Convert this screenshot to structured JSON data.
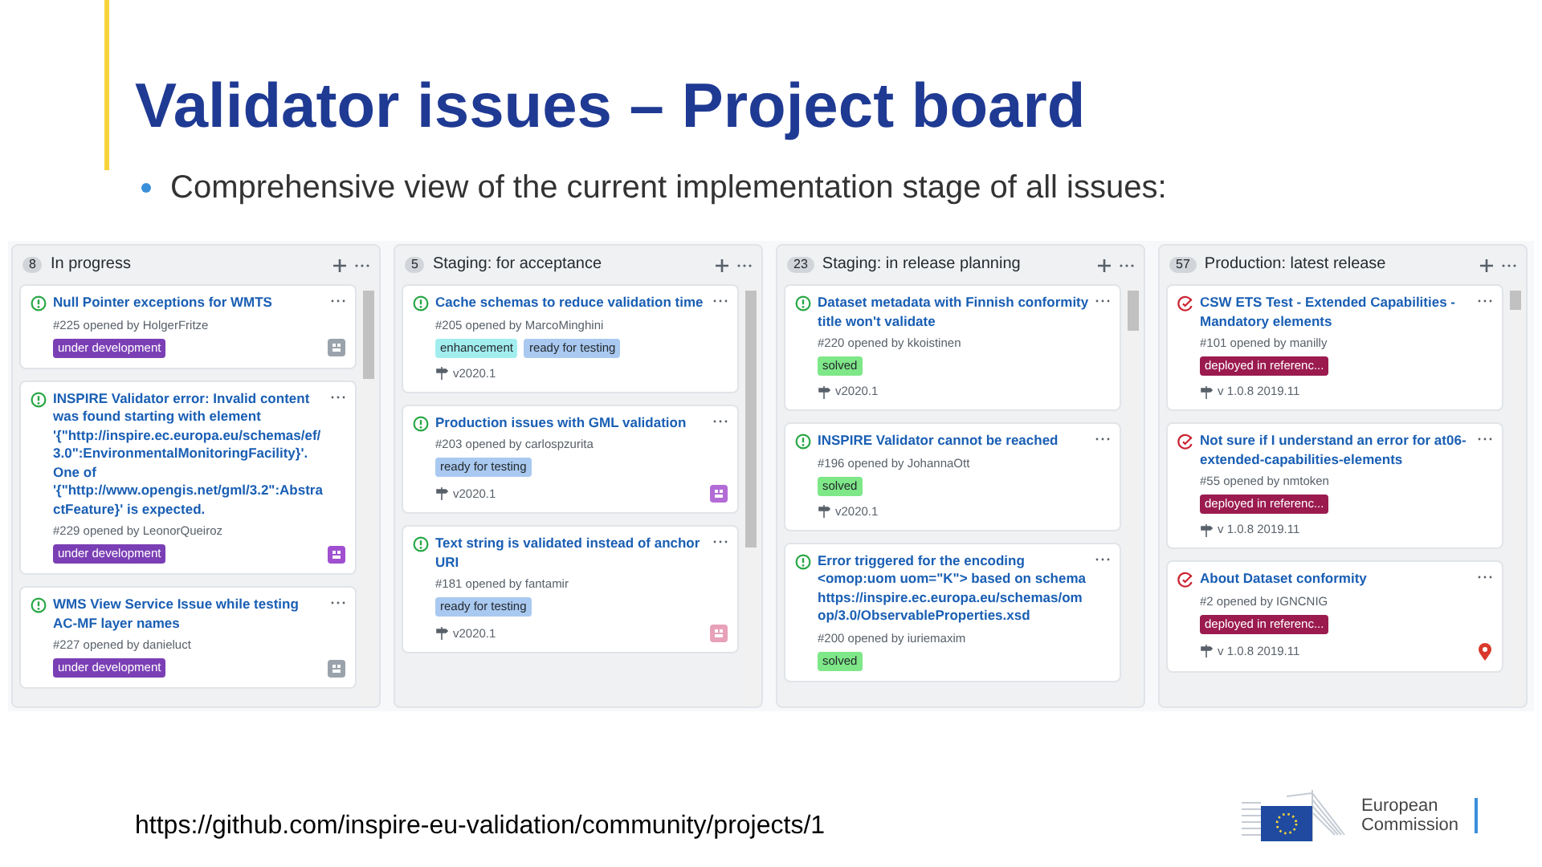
{
  "title": "Validator issues – Project board",
  "bullet": "Comprehensive view of the current implementation stage of all issues:",
  "board": {
    "columns": [
      {
        "count": "8",
        "title": "In progress",
        "cards": [
          {
            "kind": "open",
            "title": "Null Pointer exceptions for WMTS",
            "meta": "#225 opened by HolgerFritze",
            "labels": [
              {
                "text": "under development",
                "color": "#7b3fb5"
              }
            ],
            "avatar": {
              "kind": "identicon",
              "color": "#9aa3ab"
            }
          },
          {
            "kind": "open",
            "title": "INSPIRE Validator error: Invalid content was found starting with element '{\"http://inspire.ec.europa.eu/schemas/ef/3.0\":EnvironmentalMonitoringFacility}'. One of '{\"http://www.opengis.net/gml/3.2\":AbstractFeature}' is expected.",
            "meta": "#229 opened by LeonorQueiroz",
            "labels": [
              {
                "text": "under development",
                "color": "#7b3fb5"
              }
            ],
            "avatar": {
              "kind": "identicon",
              "color": "#a04fd0"
            }
          },
          {
            "kind": "open",
            "title": "WMS View Service Issue while testing AC-MF layer names",
            "meta": "#227 opened by danieluct",
            "labels": [
              {
                "text": "under development",
                "color": "#7b3fb5"
              }
            ],
            "avatar": {
              "kind": "identicon",
              "color": "#9aa3ab"
            }
          }
        ]
      },
      {
        "count": "5",
        "title": "Staging: for acceptance",
        "cards": [
          {
            "kind": "open",
            "title": "Cache schemas to reduce validation time",
            "meta": "#205 opened by MarcoMinghini",
            "labels": [
              {
                "text": "enhancement",
                "color": "#a2eeef"
              },
              {
                "text": "ready for testing",
                "color": "#a9c9f0"
              }
            ],
            "milestone": "v2020.1"
          },
          {
            "kind": "open",
            "title": "Production issues with GML validation",
            "meta": "#203 opened by carlospzurita",
            "labels": [
              {
                "text": "ready for testing",
                "color": "#a9c9f0"
              }
            ],
            "milestone": "v2020.1",
            "avatar": {
              "kind": "identicon",
              "color": "#b36bd6"
            }
          },
          {
            "kind": "open",
            "title": "Text string is validated instead of anchor URI",
            "meta": "#181 opened by fantamir",
            "labels": [
              {
                "text": "ready for testing",
                "color": "#a9c9f0"
              }
            ],
            "milestone": "v2020.1",
            "avatar": {
              "kind": "identicon",
              "color": "#e7a1b8"
            }
          }
        ]
      },
      {
        "count": "23",
        "title": "Staging: in release planning",
        "cards": [
          {
            "kind": "open",
            "title": "Dataset metadata with Finnish conformity title won't validate",
            "meta": "#220 opened by kkoistinen",
            "labels": [
              {
                "text": "solved",
                "color": "#7ee787"
              }
            ],
            "milestone": "v2020.1"
          },
          {
            "kind": "open",
            "title": "INSPIRE Validator cannot be reached",
            "meta": "#196 opened by JohannaOtt",
            "labels": [
              {
                "text": "solved",
                "color": "#7ee787"
              }
            ],
            "milestone": "v2020.1"
          },
          {
            "kind": "open",
            "title": "Error triggered for the encoding <omop:uom uom=\"K\"> based on schema https://inspire.ec.europa.eu/schemas/omop/3.0/ObservableProperties.xsd",
            "meta": "#200 opened by iuriemaxim",
            "labels": [
              {
                "text": "solved",
                "color": "#7ee787"
              }
            ]
          }
        ]
      },
      {
        "count": "57",
        "title": "Production: latest release",
        "cards": [
          {
            "kind": "closed",
            "title": "CSW ETS Test - Extended Capabilities - Mandatory elements",
            "meta": "#101 opened by manilly",
            "labels": [
              {
                "text": "deployed in referenc...",
                "color": "#9b1b4f"
              }
            ],
            "milestone": "v 1.0.8 2019.11"
          },
          {
            "kind": "closed",
            "title": "Not sure if I understand an error for at06-extended-capabilities-elements",
            "meta": "#55 opened by nmtoken",
            "labels": [
              {
                "text": "deployed in referenc...",
                "color": "#9b1b4f"
              }
            ],
            "milestone": "v 1.0.8 2019.11"
          },
          {
            "kind": "closed",
            "title": "About Dataset conformity",
            "meta": "#2 opened by IGNCNIG",
            "labels": [
              {
                "text": "deployed in referenc...",
                "color": "#9b1b4f"
              }
            ],
            "milestone": "v 1.0.8 2019.11",
            "avatar": {
              "kind": "pin",
              "color": "#d93a2b"
            }
          }
        ]
      }
    ]
  },
  "link": "https://github.com/inspire-eu-validation/community/projects/1",
  "logo": {
    "lines": [
      "European",
      "Commission"
    ]
  }
}
